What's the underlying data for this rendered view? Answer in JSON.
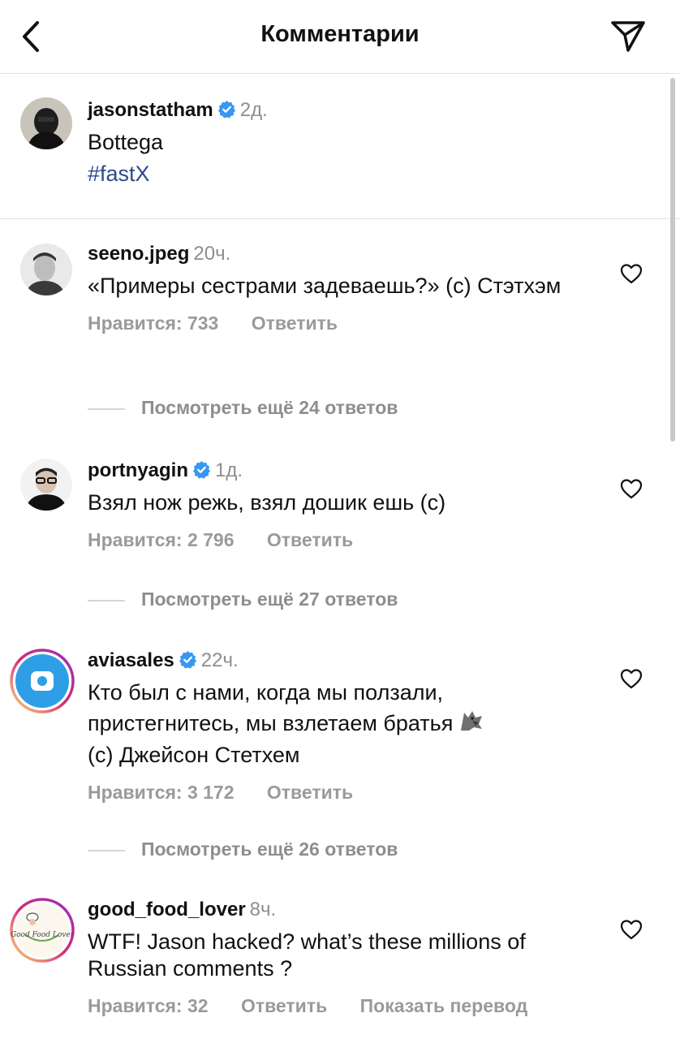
{
  "header": {
    "title": "Комментарии",
    "back_icon": "chevron-left-icon",
    "send_icon": "paper-plane-icon"
  },
  "post": {
    "username": "jasonstatham",
    "verified": true,
    "time": "2д.",
    "caption": "Bottega",
    "hashtag": "#fastX"
  },
  "comments": [
    {
      "username": "seeno.jpeg",
      "verified": false,
      "time": "20ч.",
      "text": "«Примеры сестрами задеваешь?» (с) Стэтхэм",
      "likes": "Нравится: 733",
      "reply": "Ответить",
      "view_replies": "Посмотреть ещё 24 ответов"
    },
    {
      "username": "portnyagin",
      "verified": true,
      "time": "1д.",
      "text": "Взял нож режь, взял дошик ешь (с)",
      "likes": "Нравится: 2 796",
      "reply": "Ответить",
      "view_replies": "Посмотреть ещё 27 ответов"
    },
    {
      "username": "aviasales",
      "verified": true,
      "time": "22ч.",
      "text_line1": "Кто был с нами, когда мы ползали,",
      "text_line2": "пристегнитесь, мы взлетаем братья",
      "text_line3": "(с) Джейсон Стетхем",
      "emoji_icon": "wolf-emoji-icon",
      "likes": "Нравится: 3 172",
      "reply": "Ответить",
      "view_replies": "Посмотреть ещё 26 ответов"
    },
    {
      "username": "good_food_lover",
      "verified": false,
      "time": "8ч.",
      "text": "WTF! Jason hacked? what’s these millions of Russian comments ?",
      "likes": "Нравится: 32",
      "reply": "Ответить",
      "translate": "Показать перевод",
      "avatar_text": "Good Food Lover"
    }
  ],
  "colors": {
    "verified": "#3897f0",
    "hashtag": "#2b4b8a",
    "meta_gray": "#9a9a9a",
    "story_ring": "#d6249f"
  }
}
